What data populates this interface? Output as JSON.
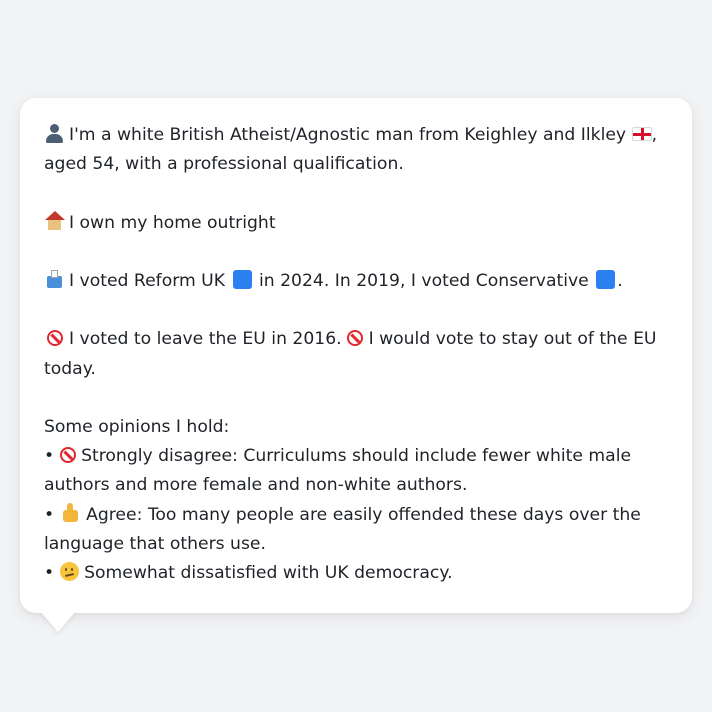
{
  "profile": {
    "identity_icon": "bust-in-silhouette-icon",
    "identity_text_a": "I'm a white British Atheist/Agnostic man from Keighley and Ilkley",
    "identity_flag": "england-flag-icon",
    "identity_text_b": ", aged 54, with a professional qualification.",
    "home_icon": "house-icon",
    "home_text": "I own my home outright",
    "vote_icon": "ballot-box-icon",
    "vote_text_a": "I voted Reform UK",
    "vote_text_b": "in 2024. In 2019, I voted Conservative",
    "vote_text_c": ".",
    "party_colors": {
      "reform_uk": "#2c7ff0",
      "conservative": "#2c7ff0"
    },
    "eu_icon": "no-entry-icon",
    "eu_text_a": "I voted to leave the EU in 2016.",
    "eu_text_b": "I would vote to stay out of the EU today.",
    "opinions_heading": "Some opinions I hold:",
    "opinions": [
      {
        "bullet": "•",
        "icon": "no-entry-icon",
        "text": "Strongly disagree: Curriculums should include fewer white male authors and more female and non-white authors."
      },
      {
        "bullet": "•",
        "icon": "thumbs-up-icon",
        "text": "Agree: Too many people are easily offended these days over the language that others use."
      },
      {
        "bullet": "•",
        "icon": "confused-face-icon",
        "text": "Somewhat dissatisfied with UK democracy."
      }
    ]
  }
}
